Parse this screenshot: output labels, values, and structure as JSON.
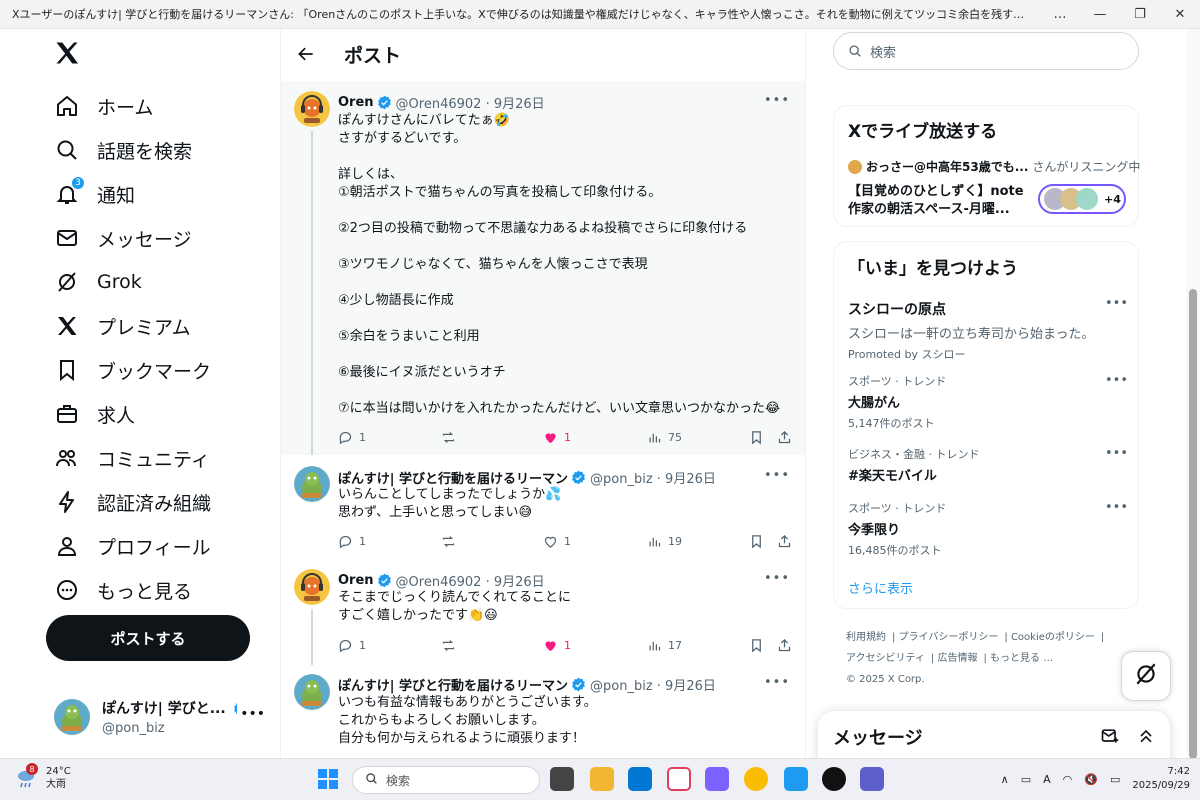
{
  "window": {
    "title": "Xユーザーのぽんすけ| 学びと行動を届けるリーマンさん: 「Orenさんのこのポスト上手いな。Xで伸びるのは知識量や権威だけじゃなく、キャラ性や人懐っこさ。それを動物に例えてツッコミ余白を残すことで、自然にリプや引用を誘発してる。さらに犬派っ...",
    "controls": [
      "…",
      "—",
      "❐",
      "✕"
    ]
  },
  "nav": {
    "items": [
      {
        "id": "home",
        "label": "ホーム"
      },
      {
        "id": "explore",
        "label": "話題を検索"
      },
      {
        "id": "notifications",
        "label": "通知",
        "badge": "3"
      },
      {
        "id": "messages",
        "label": "メッセージ"
      },
      {
        "id": "grok",
        "label": "Grok"
      },
      {
        "id": "premium",
        "label": "プレミアム"
      },
      {
        "id": "bookmarks",
        "label": "ブックマーク"
      },
      {
        "id": "jobs",
        "label": "求人"
      },
      {
        "id": "communities",
        "label": "コミュニティ"
      },
      {
        "id": "verified-orgs",
        "label": "認証済み組織"
      },
      {
        "id": "profile",
        "label": "プロフィール"
      },
      {
        "id": "more",
        "label": "もっと見る"
      }
    ],
    "post_button": "ポストする",
    "account": {
      "name": "ぽんすけ| 学びと...",
      "handle": "@pon_biz",
      "more": "•••"
    }
  },
  "center": {
    "header_title": "ポスト",
    "tweets": [
      {
        "name": "Oren",
        "meta": "@Oren46902 · 9月26日",
        "text": "ぽんすけさんにバレてたぁ🤣\nさすがするどいです。\n\n詳しくは、\n①朝活ポストで猫ちゃんの写真を投稿して印象付ける。\n\n②2つ目の投稿で動物って不思議な力あるよね投稿でさらに印象付ける\n\n③ツワモノじゃなくて、猫ちゃんを人懐っこさで表現\n\n④少し物語長に作成\n\n⑤余白をうまいこと利用\n\n⑥最後にイヌ派だというオチ\n\n⑦に本当は問いかけを入れたかったんだけど、いい文章思いつかなかった😂",
        "replies": "1",
        "retweets": "",
        "likes": "1",
        "views": "75",
        "liked": true
      },
      {
        "name": "ぽんすけ| 学びと行動を届けるリーマン",
        "meta": "@pon_biz · 9月26日",
        "text": "いらんことしてしまったでしょうか💦\n思わず、上手いと思ってしまい😅",
        "replies": "1",
        "retweets": "",
        "likes": "1",
        "views": "19",
        "liked": false
      },
      {
        "name": "Oren",
        "meta": "@Oren46902 · 9月26日",
        "text": "そこまでじっくり読んでくれてることに\nすごく嬉しかったです👏😃",
        "replies": "1",
        "retweets": "",
        "likes": "1",
        "views": "17",
        "liked": true
      },
      {
        "name": "ぽんすけ| 学びと行動を届けるリーマン",
        "meta": "@pon_biz · 9月26日",
        "text": "いつも有益な情報もありがとうございます。\nこれからもよろしくお願いします。\n自分も何か与えられるように頑張ります！",
        "replies": "",
        "retweets": "",
        "likes": "",
        "views": "",
        "liked": false
      }
    ]
  },
  "right": {
    "search_placeholder": "検索",
    "live": {
      "title": "Xでライブ放送する",
      "host": "おっさー@中高年53歳でも...",
      "host_status": "さんがリスニング中",
      "space_title_1": "【目覚めのひとしずく】note",
      "space_title_2": "作家の朝活スペース-月曜...",
      "listeners_extra": "+4"
    },
    "explore": {
      "title": "「いま」を見つけよう",
      "promo": {
        "name": "スシローの原点",
        "desc": "スシローは一軒の立ち寿司から始まった。",
        "by": "Promoted by スシロー"
      },
      "trends": [
        {
          "category": "スポーツ · トレンド",
          "name": "大腸がん",
          "count": "5,147件のポスト"
        },
        {
          "category": "ビジネス・金融 · トレンド",
          "name": "#楽天モバイル",
          "count": ""
        },
        {
          "category": "スポーツ · トレンド",
          "name": "今季限り",
          "count": "16,485件のポスト"
        }
      ],
      "show_more": "さらに表示"
    },
    "footer": {
      "links": [
        "利用規約",
        "プライバシーポリシー",
        "Cookieのポリシー",
        "アクセシビリティ",
        "広告情報",
        "もっと見る …"
      ],
      "copyright": "© 2025 X Corp."
    },
    "messages_drawer": {
      "title": "メッセージ"
    }
  },
  "taskbar": {
    "weather_badge": "8",
    "temperature": "24°C",
    "condition": "大雨",
    "search_placeholder": "検索",
    "time": "7:42",
    "date": "2025/09/29",
    "ime": "A"
  },
  "colors": {
    "accent": "#1d9bf0",
    "like": "#f91880",
    "text": "#0f1419",
    "muted": "#536471"
  }
}
